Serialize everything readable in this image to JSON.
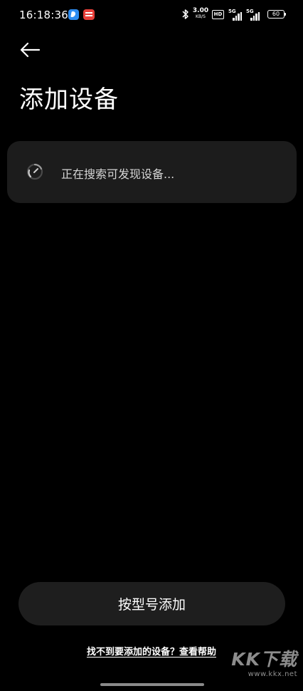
{
  "status_bar": {
    "time": "16:18:36",
    "notification_icons": [
      "blue-app-icon",
      "red-app-icon"
    ],
    "network_speed_value": "3.00",
    "network_speed_unit": "KB/S",
    "hd_badge": "HD",
    "signal_1_label": "5G",
    "signal_2_label": "5G",
    "battery": "60"
  },
  "header": {
    "back_icon": "arrow-left-icon",
    "title": "添加设备"
  },
  "search_card": {
    "spinner_icon": "loading-spinner-icon",
    "status_text": "正在搜索可发现设备..."
  },
  "actions": {
    "add_by_model_label": "按型号添加",
    "help_link_text": "找不到要添加的设备？查看帮助"
  },
  "watermark": {
    "brand": "KK下载",
    "site": "www.kkx.net"
  },
  "colors": {
    "background": "#000000",
    "card": "#1c1c1c",
    "button": "#1e1e1e",
    "text_primary": "#ffffff",
    "text_secondary": "#d6d6d6"
  }
}
